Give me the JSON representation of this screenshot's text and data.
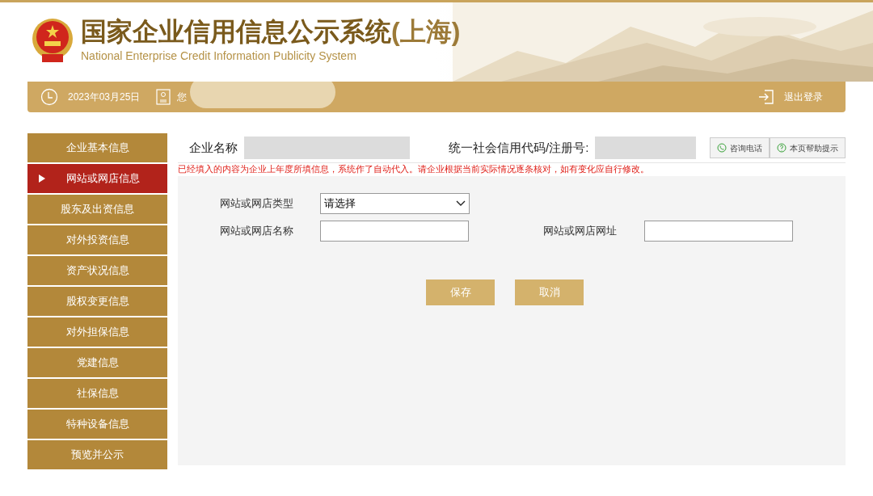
{
  "header": {
    "title": "国家企业信用信息公示系统",
    "region": "(上海)",
    "subtitle": "National Enterprise Credit Information Publicity System"
  },
  "user_bar": {
    "date": "2023年03月25日",
    "greeting": "您",
    "logout": "退出登录"
  },
  "sidebar": {
    "items": [
      {
        "label": "企业基本信息",
        "selected": false
      },
      {
        "label": "网站或网店信息",
        "selected": true
      },
      {
        "label": "股东及出资信息",
        "selected": false
      },
      {
        "label": "对外投资信息",
        "selected": false
      },
      {
        "label": "资产状况信息",
        "selected": false
      },
      {
        "label": "股权变更信息",
        "selected": false
      },
      {
        "label": "对外担保信息",
        "selected": false
      },
      {
        "label": "党建信息",
        "selected": false
      },
      {
        "label": "社保信息",
        "selected": false
      },
      {
        "label": "特种设备信息",
        "selected": false
      },
      {
        "label": "预览并公示",
        "selected": false
      }
    ]
  },
  "company": {
    "name_label": "企业名称",
    "code_label": "统一社会信用代码/注册号:"
  },
  "help_buttons": [
    "咨询电话",
    "本页帮助提示"
  ],
  "notice": "已经填入的内容为企业上年度所填信息，系统作了自动代入。请企业根据当前实际情况逐条核对，如有变化应自行修改。",
  "form": {
    "type_label": "网站或网店类型",
    "type_value": "请选择",
    "name_label": "网站或网店名称",
    "url_label": "网站或网店网址"
  },
  "buttons": [
    "保存",
    "取消"
  ]
}
